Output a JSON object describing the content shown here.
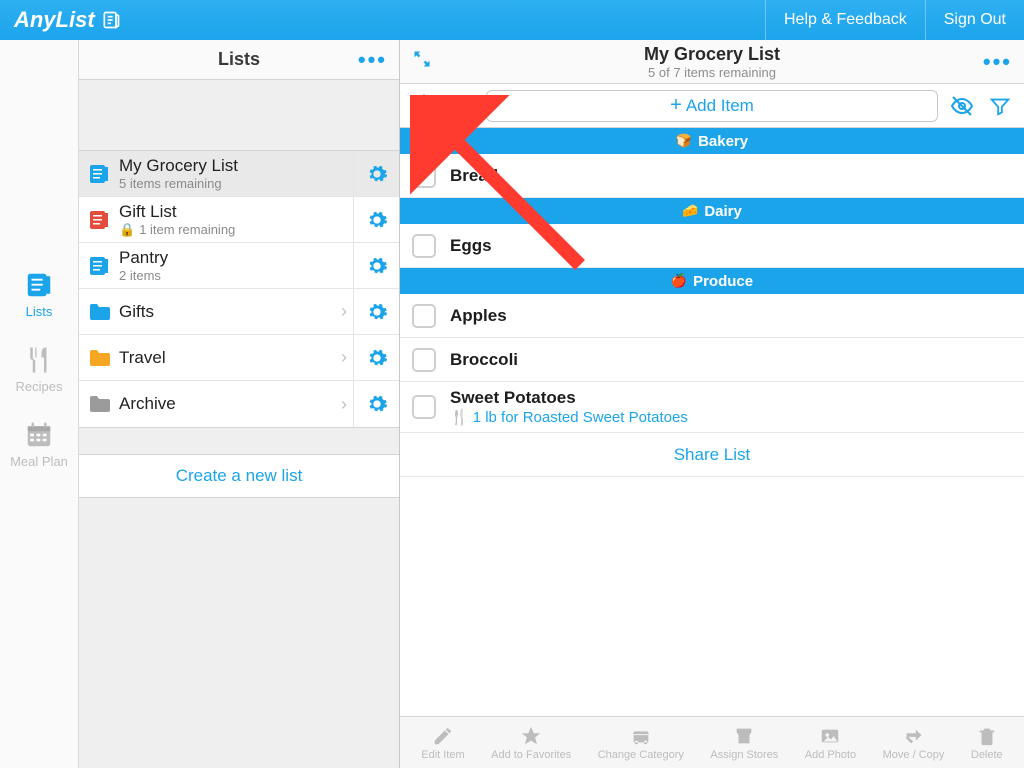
{
  "brand": "AnyList",
  "topbar": {
    "help": "Help & Feedback",
    "signout": "Sign Out"
  },
  "rail": {
    "lists": "Lists",
    "recipes": "Recipes",
    "mealplan": "Meal Plan"
  },
  "mid": {
    "title": "Lists",
    "create": "Create a new list",
    "rows": [
      {
        "title": "My Grocery List",
        "sub": "5 items remaining",
        "icon": "list-blue",
        "selected": true
      },
      {
        "title": "Gift List",
        "sub": "1 item remaining",
        "icon": "list-red",
        "locked": true
      },
      {
        "title": "Pantry",
        "sub": "2 items",
        "icon": "list-blue"
      },
      {
        "title": "Gifts",
        "icon": "folder-blue",
        "chevron": true
      },
      {
        "title": "Travel",
        "icon": "folder-orange",
        "chevron": true
      },
      {
        "title": "Archive",
        "icon": "folder-gray",
        "chevron": true
      }
    ]
  },
  "detail": {
    "title": "My Grocery List",
    "subtitle": "5 of 7 items remaining",
    "additem": "Add Item",
    "share": "Share List",
    "categories": [
      {
        "name": "Bakery",
        "icon": "bread-icon",
        "items": [
          {
            "name": "Bread"
          }
        ]
      },
      {
        "name": "Dairy",
        "icon": "cheese-icon",
        "items": [
          {
            "name": "Eggs"
          }
        ]
      },
      {
        "name": "Produce",
        "icon": "apple-icon",
        "items": [
          {
            "name": "Apples"
          },
          {
            "name": "Broccoli"
          },
          {
            "name": "Sweet Potatoes",
            "note": "1 lb for Roasted Sweet Potatoes"
          }
        ]
      }
    ]
  },
  "bottombar": {
    "edit": "Edit Item",
    "fav": "Add to Favorites",
    "cat": "Change Category",
    "stores": "Assign Stores",
    "photo": "Add Photo",
    "move": "Move / Copy",
    "delete": "Delete"
  }
}
